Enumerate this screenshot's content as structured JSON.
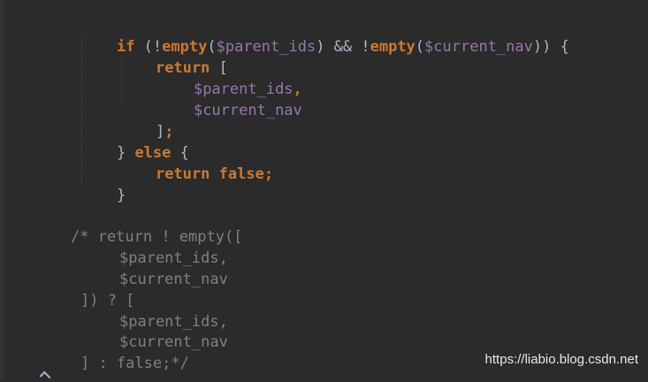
{
  "code": {
    "if_line": {
      "kw_if": "if",
      "p1": " (!",
      "fn1": "empty",
      "p2": "(",
      "v1": "$parent_ids",
      "p3": ") && !",
      "fn2": "empty",
      "p4": "(",
      "v2": "$current_nav",
      "p5": ")) {"
    },
    "return_line": {
      "kw": "return",
      "rest": " ["
    },
    "arr_item_1": {
      "var": "$parent_ids",
      "punc": ","
    },
    "arr_item_2": {
      "var": "$current_nav"
    },
    "close_arr": {
      "bracket": "]",
      "semi": ";"
    },
    "else_line": {
      "brace": "} ",
      "kw": "else",
      "rest": " {"
    },
    "return_false_line": {
      "kw_return": "return",
      "kw_false": "false",
      "semi": ";"
    },
    "close_brace": "}"
  },
  "comment_block": {
    "line1": "/* return ! empty([",
    "line2": "$parent_ids,",
    "line3": "$current_nav",
    "line4": "]) ? [",
    "line5": "$parent_ids,",
    "line6": "$current_nav",
    "line7": "] : false;*/"
  },
  "watermark": "https://liabio.blog.csdn.net"
}
